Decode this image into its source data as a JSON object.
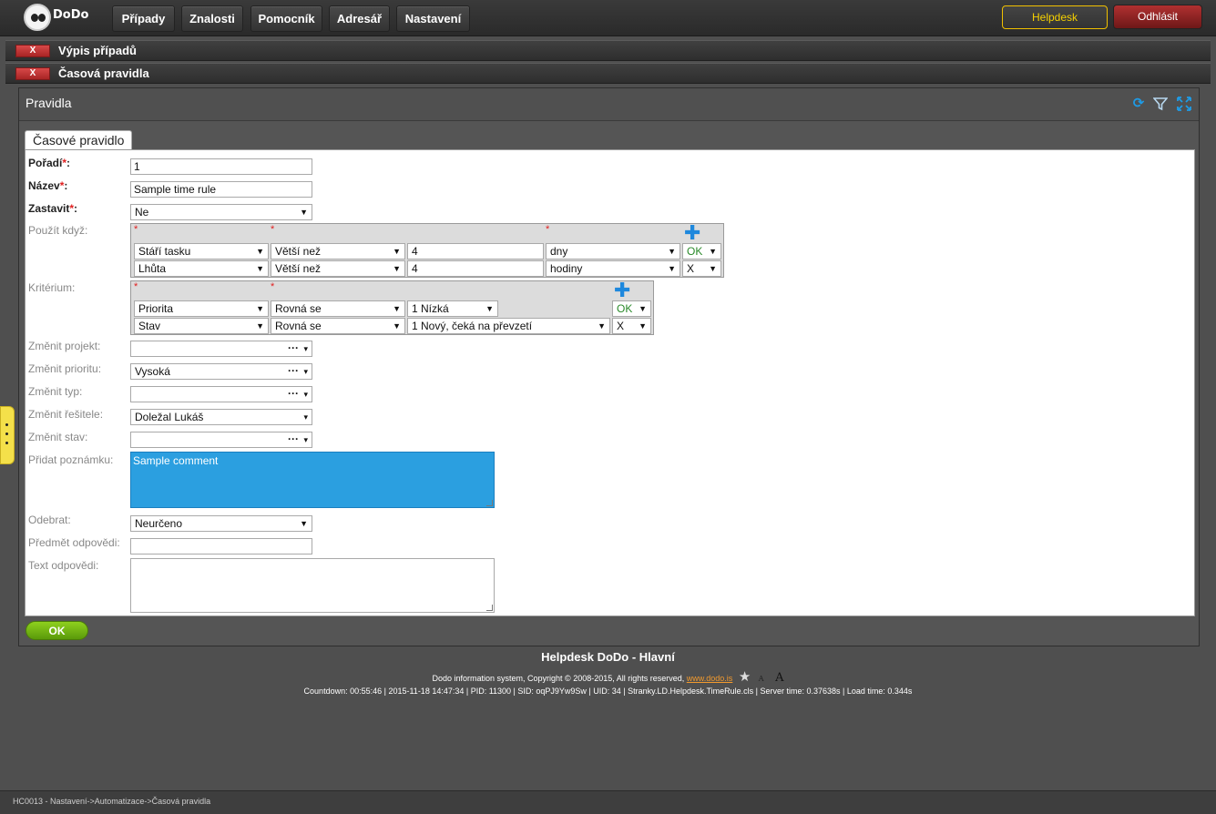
{
  "app": {
    "logo_text": "DoDo",
    "nav": [
      "Případy",
      "Znalosti",
      "Pomocník",
      "Adresář",
      "Nastavení"
    ],
    "helpdesk_label": "Helpdesk",
    "logout_label": "Odhlásit"
  },
  "sections": [
    {
      "close_label": "X",
      "title": "Výpis případů"
    },
    {
      "close_label": "X",
      "title": "Časová pravidla"
    }
  ],
  "panel": {
    "title": "Pravidla",
    "tab": "Časové pravidlo"
  },
  "form": {
    "poradi": {
      "label": "Pořadí",
      "req": "*",
      "colon": ":",
      "value": "1"
    },
    "nazev": {
      "label": "Název",
      "req": "*",
      "colon": ":",
      "value": "Sample time rule"
    },
    "zastavit": {
      "label": "Zastavit",
      "req": "*",
      "colon": ":",
      "value": "Ne"
    },
    "pouzit_kdyz": {
      "label": "Použít když:",
      "rows": [
        {
          "field": "Stáří tasku",
          "op": "Větší než",
          "value": "4",
          "unit": "dny",
          "action": "OK"
        },
        {
          "field": "Lhůta",
          "op": "Větší než",
          "value": "4",
          "unit": "hodiny",
          "action": "X"
        }
      ]
    },
    "kriterium": {
      "label": "Kritérium:",
      "rows": [
        {
          "field": "Priorita",
          "op": "Rovná se",
          "value": "1 Nízká",
          "action": "OK"
        },
        {
          "field": "Stav",
          "op": "Rovná se",
          "value": "1 Nový, čeká na převzetí",
          "action": "X"
        }
      ]
    },
    "zmenit_projekt": {
      "label": "Změnit projekt:",
      "value": ""
    },
    "zmenit_prioritu": {
      "label": "Změnit prioritu:",
      "value": "Vysoká"
    },
    "zmenit_typ": {
      "label": "Změnit typ:",
      "value": ""
    },
    "zmenit_resitele": {
      "label": "Změnit řešitele:",
      "value": "Doležal Lukáš"
    },
    "zmenit_stav": {
      "label": "Změnit stav:",
      "value": ""
    },
    "pridat_poznamku": {
      "label": "Přidat poznámku:",
      "value": "Sample comment"
    },
    "odebrat": {
      "label": "Odebrat:",
      "value": "Neurčeno"
    },
    "predmet_odpovedi": {
      "label": "Předmět odpovědi:",
      "value": ""
    },
    "text_odpovedi": {
      "label": "Text odpovědi:",
      "value": ""
    },
    "ok_label": "OK"
  },
  "footer": {
    "title": "Helpdesk DoDo - Hlavní",
    "copyright": "Dodo information system, Copyright © 2008-2015, All rights reserved,",
    "link": "www.dodo.is",
    "font_small": "A",
    "font_large": "A",
    "info": "Countdown: 00:55:46 | 2015-11-18 14:47:34 | PID: 11300 | SID: oqPJ9Yw9Sw | UID: 34 | Stranky.LD.Helpdesk.TimeRule.cls | Server time: 0.37638s | Load time: 0.344s"
  },
  "statusbar": "HC0013 - Nastavení->Automatizace->Časová pravidla",
  "icons": {
    "refresh": "refresh-icon",
    "filter": "filter-icon",
    "expand": "expand-icon",
    "star": "star-icon"
  }
}
